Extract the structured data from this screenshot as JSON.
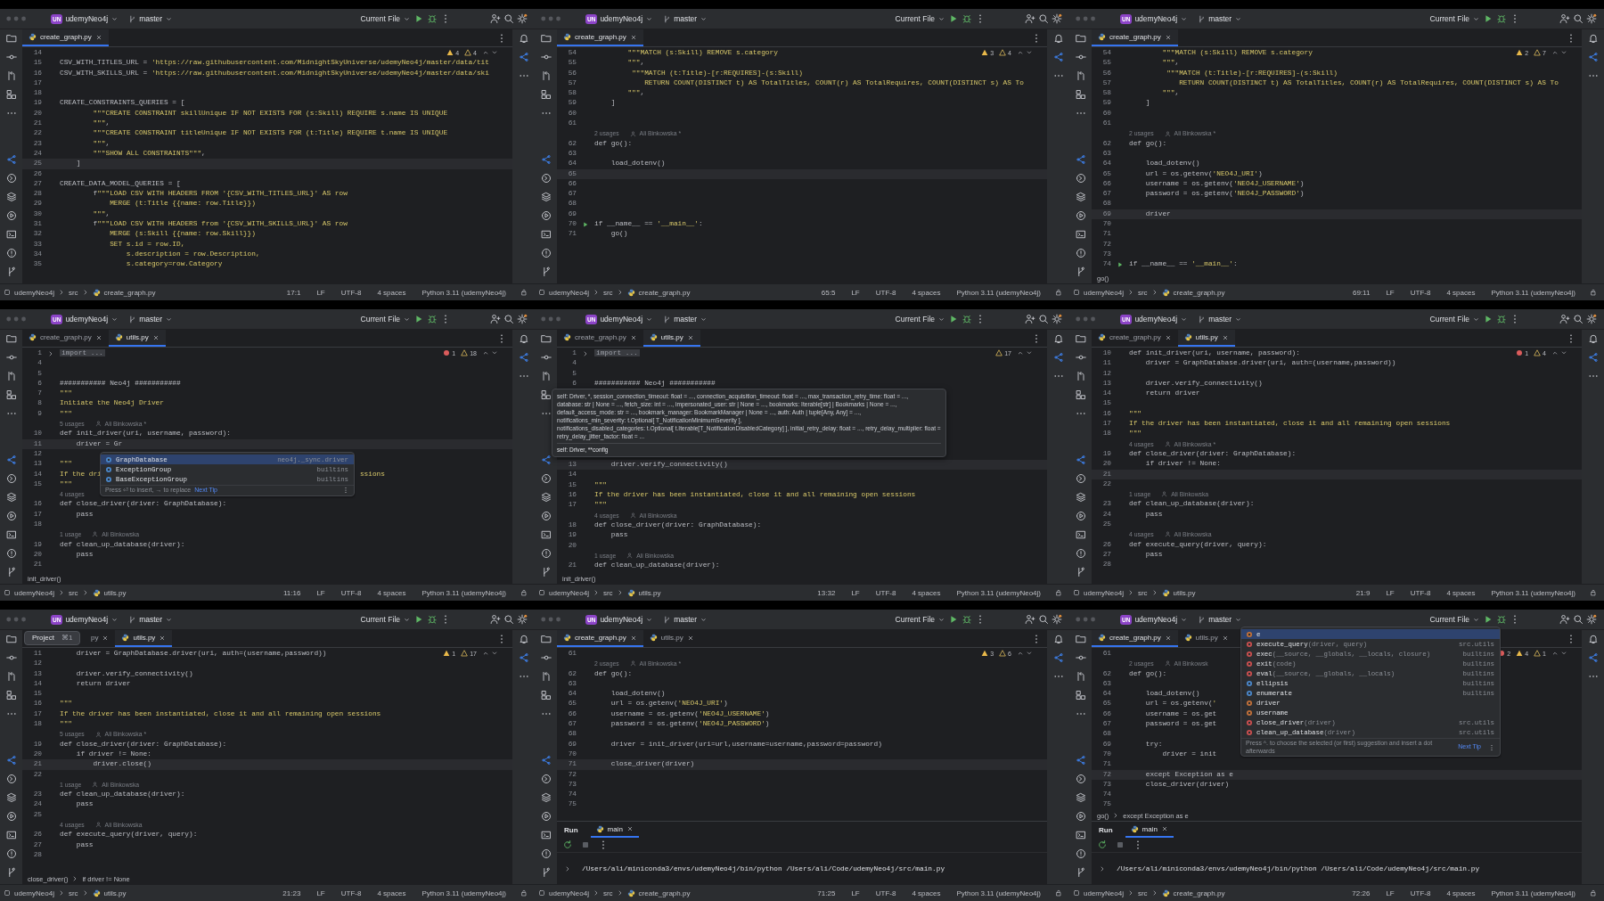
{
  "panels": [
    {
      "project_badge": "UN",
      "project": "udemyNeo4j",
      "branch": "master",
      "run_config": "Current File",
      "tabs": [
        {
          "label": "create_graph.py",
          "selected": true,
          "partial": false
        }
      ],
      "inspections": [
        {
          "kind": "warning",
          "count": "4"
        },
        {
          "kind": "weak",
          "count": "4"
        }
      ],
      "lines": [
        {
          "kind": "code",
          "n": "14"
        },
        {
          "kind": "code",
          "n": "15",
          "text": "CSV_WITH_TITLES_URL = 'https://raw.githubusercontent.com/MidnightSkyUniverse/udemyNeo4j/master/data/tit"
        },
        {
          "kind": "code",
          "n": "16",
          "text": "CSV_WITH_SKILLS_URL = 'https://raw.githubusercontent.com/MidnightSkyUniverse/udemyNeo4j/master/data/ski"
        },
        {
          "kind": "code",
          "n": "17"
        },
        {
          "kind": "code",
          "n": "18"
        },
        {
          "kind": "code",
          "n": "19",
          "text": "CREATE_CONSTRAINTS_QUERIES = ["
        },
        {
          "kind": "code",
          "n": "20",
          "text": "        \"\"\"CREATE CONSTRAINT skillUnique IF NOT EXISTS FOR (s:Skill) REQUIRE s.name IS UNIQUE"
        },
        {
          "kind": "code",
          "n": "21",
          "text": "        \"\"\","
        },
        {
          "kind": "code",
          "n": "22",
          "text": "        \"\"\"CREATE CONSTRAINT titleUnique IF NOT EXISTS FOR (t:Title) REQUIRE t.name IS UNIQUE"
        },
        {
          "kind": "code",
          "n": "23",
          "text": "        \"\"\","
        },
        {
          "kind": "code",
          "n": "24",
          "text": "        \"\"\"SHOW ALL CONSTRAINTS\"\"\","
        },
        {
          "kind": "current",
          "n": "25",
          "text": "    ]"
        },
        {
          "kind": "code",
          "n": "26"
        },
        {
          "kind": "code",
          "n": "27",
          "text": "CREATE_DATA_MODEL_QUERIES = ["
        },
        {
          "kind": "code",
          "n": "28",
          "text": "        f\"\"\"LOAD CSV WITH HEADERS FROM '{CSV_WITH_TITLES_URL}' AS row"
        },
        {
          "kind": "code",
          "n": "29",
          "text": "            MERGE (t:Title {{name: row.Title}})"
        },
        {
          "kind": "code",
          "n": "30",
          "text": "        \"\"\","
        },
        {
          "kind": "code",
          "n": "31",
          "text": "        f\"\"\"LOAD CSV WITH HEADERS from '{CSV_WITH_SKILLS_URL}' AS row"
        },
        {
          "kind": "code",
          "n": "32",
          "text": "            MERGE (s:Skill {{name: row.Skill}})"
        },
        {
          "kind": "code",
          "n": "33",
          "text": "            SET s.id = row.ID,"
        },
        {
          "kind": "code",
          "n": "34",
          "text": "                s.description = row.Description,"
        },
        {
          "kind": "code",
          "n": "35",
          "text": "                s.category=row.Category"
        }
      ],
      "status": {
        "path": [
          "udemyNeo4j",
          "src",
          "create_graph.py"
        ],
        "position": "17:1",
        "line_sep": "LF",
        "encoding": "UTF-8",
        "indent": "4 spaces",
        "interpreter": "Python 3.11 (udemyNeo4j)"
      }
    },
    {
      "project_badge": "UN",
      "project": "udemyNeo4j",
      "branch": "master",
      "run_config": "Current File",
      "tabs": [
        {
          "label": "create_graph.py",
          "selected": true,
          "partial": false
        }
      ],
      "inspections": [
        {
          "kind": "warning",
          "count": "3"
        },
        {
          "kind": "weak",
          "count": "4"
        }
      ],
      "lines": [
        {
          "kind": "code",
          "n": "54",
          "text": "        \"\"\"MATCH (s:Skill) REMOVE s.category"
        },
        {
          "kind": "code",
          "n": "55",
          "text": "        \"\"\","
        },
        {
          "kind": "code",
          "n": "56",
          "text": "         \"\"\"MATCH (t:Title)-[r:REQUIRES]-(s:Skill)"
        },
        {
          "kind": "code",
          "n": "57",
          "text": "            RETURN COUNT(DISTINCT t) AS TotalTitles, COUNT(r) AS TotalRequires, COUNT(DISTINCT s) AS To"
        },
        {
          "kind": "code",
          "n": "58",
          "text": "        \"\"\","
        },
        {
          "kind": "code",
          "n": "59",
          "text": "    ]"
        },
        {
          "kind": "code",
          "n": "60"
        },
        {
          "kind": "code",
          "n": "61"
        },
        {
          "kind": "hint",
          "usages": "2 usages",
          "author": "Ali Binkowska *"
        },
        {
          "kind": "code",
          "n": "62",
          "text": "def go():"
        },
        {
          "kind": "code",
          "n": "63"
        },
        {
          "kind": "code",
          "n": "64",
          "text": "    load_dotenv()"
        },
        {
          "kind": "current",
          "n": "65"
        },
        {
          "kind": "code",
          "n": "66"
        },
        {
          "kind": "code",
          "n": "67"
        },
        {
          "kind": "code",
          "n": "68"
        },
        {
          "kind": "code",
          "n": "69"
        },
        {
          "kind": "runnable",
          "n": "70",
          "text": "if __name__ == '__main__':"
        },
        {
          "kind": "code",
          "n": "71",
          "text": "    go()"
        }
      ],
      "status": {
        "path": [
          "udemyNeo4j",
          "src",
          "create_graph.py"
        ],
        "position": "65:5",
        "line_sep": "LF",
        "encoding": "UTF-8",
        "indent": "4 spaces",
        "interpreter": "Python 3.11 (udemyNeo4j)"
      }
    },
    {
      "project_badge": "UN",
      "project": "udemyNeo4j",
      "branch": "master",
      "run_config": "Current File",
      "tabs": [
        {
          "label": "create_graph.py",
          "selected": true,
          "partial": false
        }
      ],
      "inspections": [
        {
          "kind": "warning",
          "count": "2"
        },
        {
          "kind": "weak",
          "count": "7"
        }
      ],
      "lines": [
        {
          "kind": "code",
          "n": "54",
          "text": "        \"\"\"MATCH (s:Skill) REMOVE s.category"
        },
        {
          "kind": "code",
          "n": "55",
          "text": "        \"\"\","
        },
        {
          "kind": "code",
          "n": "56",
          "text": "         \"\"\"MATCH (t:Title)-[r:REQUIRES]-(s:Skill)"
        },
        {
          "kind": "code",
          "n": "57",
          "text": "            RETURN COUNT(DISTINCT t) AS TotalTitles, COUNT(r) AS TotalRequires, COUNT(DISTINCT s) AS To"
        },
        {
          "kind": "code",
          "n": "58",
          "text": "        \"\"\","
        },
        {
          "kind": "code",
          "n": "59",
          "text": "    ]"
        },
        {
          "kind": "code",
          "n": "60"
        },
        {
          "kind": "code",
          "n": "61"
        },
        {
          "kind": "hint",
          "usages": "2 usages",
          "author": "Ali Binkowska *"
        },
        {
          "kind": "code",
          "n": "62",
          "text": "def go():"
        },
        {
          "kind": "code",
          "n": "63"
        },
        {
          "kind": "code",
          "n": "64",
          "text": "    load_dotenv()"
        },
        {
          "kind": "code",
          "n": "65",
          "text": "    url = os.getenv('NEO4J_URI')"
        },
        {
          "kind": "code",
          "n": "66",
          "text": "    username = os.getenv('NEO4J_USERNAME')"
        },
        {
          "kind": "code",
          "n": "67",
          "text": "    password = os.getenv('NEO4J_PASSWORD')"
        },
        {
          "kind": "code",
          "n": "68"
        },
        {
          "kind": "current",
          "n": "69",
          "text": "    driver"
        },
        {
          "kind": "code",
          "n": "70"
        },
        {
          "kind": "code",
          "n": "71"
        },
        {
          "kind": "code",
          "n": "72"
        },
        {
          "kind": "code",
          "n": "73"
        },
        {
          "kind": "runnable",
          "n": "74",
          "text": "if __name__ == '__main__':"
        }
      ],
      "breadcrumb": [
        "go()"
      ],
      "status": {
        "path": [
          "udemyNeo4j",
          "src",
          "create_graph.py"
        ],
        "position": "69:11",
        "line_sep": "LF",
        "encoding": "UTF-8",
        "indent": "4 spaces",
        "interpreter": "Python 3.11 (udemyNeo4j)"
      }
    },
    {
      "project_badge": "UN",
      "project": "udemyNeo4j",
      "branch": "master",
      "run_config": "Current File",
      "tabs": [
        {
          "label": "create_graph.py",
          "selected": false,
          "partial": false
        },
        {
          "label": "utils.py",
          "selected": true,
          "partial": false
        }
      ],
      "inspections": [
        {
          "kind": "error",
          "count": "1"
        },
        {
          "kind": "weak",
          "count": "18"
        }
      ],
      "lines": [
        {
          "kind": "folded",
          "n": "1",
          "text": "import ..."
        },
        {
          "kind": "code",
          "n": "4"
        },
        {
          "kind": "code",
          "n": "5"
        },
        {
          "kind": "code",
          "n": "6",
          "text": "########### Neo4j ###########"
        },
        {
          "kind": "code",
          "n": "7",
          "text": "\"\"\""
        },
        {
          "kind": "code",
          "n": "8",
          "text": "Initiate the Neo4j Driver"
        },
        {
          "kind": "code",
          "n": "9",
          "text": "\"\"\""
        },
        {
          "kind": "hint",
          "usages": "5 usages",
          "author": "Ali Binkowska *"
        },
        {
          "kind": "code",
          "n": "10",
          "text": "def init_driver(uri, username, password):"
        },
        {
          "kind": "current",
          "n": "11",
          "text": "    driver = Gr"
        },
        {
          "kind": "code",
          "n": "12"
        },
        {
          "kind": "code",
          "n": "13",
          "text": "\"\"\""
        },
        {
          "kind": "code",
          "n": "14",
          "text": "If the dri",
          "tail": "ssions"
        },
        {
          "kind": "code",
          "n": "15",
          "text": "\"\"\""
        },
        {
          "kind": "hint",
          "usages": "4 usages"
        },
        {
          "kind": "code",
          "n": "16",
          "text": "def close_driver(driver: GraphDatabase):"
        },
        {
          "kind": "code",
          "n": "17",
          "text": "    pass"
        },
        {
          "kind": "code",
          "n": "18"
        },
        {
          "kind": "hint",
          "usages": "1 usage",
          "author": "Ali Binkowska"
        },
        {
          "kind": "code",
          "n": "19",
          "text": "def clean_up_database(driver):"
        },
        {
          "kind": "code",
          "n": "20",
          "text": "    pass"
        },
        {
          "kind": "code",
          "n": "21"
        }
      ],
      "breadcrumb": [
        "init_driver()"
      ],
      "completion": {
        "items": [
          {
            "kind": "class",
            "name": "GraphDatabase",
            "source": "neo4j._sync.driver",
            "selected": true
          },
          {
            "kind": "class",
            "name": "ExceptionGroup",
            "source": "builtins",
            "selected": false
          },
          {
            "kind": "class",
            "name": "BaseExceptionGroup",
            "source": "builtins",
            "selected": false
          }
        ],
        "footer": "Press ⏎ to insert, → to replace",
        "tip_link": "Next Tip"
      },
      "status": {
        "path": [
          "udemyNeo4j",
          "src",
          "utils.py"
        ],
        "position": "11:16",
        "line_sep": "LF",
        "encoding": "UTF-8",
        "indent": "4 spaces",
        "interpreter": "Python 3.11 (udemyNeo4j)"
      }
    },
    {
      "project_badge": "UN",
      "project": "udemyNeo4j",
      "branch": "master",
      "run_config": "Current File",
      "tabs": [
        {
          "label": "create_graph.py",
          "selected": false,
          "partial": false
        },
        {
          "label": "utils.py",
          "selected": true,
          "partial": false
        }
      ],
      "inspections": [
        {
          "kind": "weak",
          "count": "17"
        }
      ],
      "lines": [
        {
          "kind": "folded",
          "n": "1",
          "text": "import ..."
        },
        {
          "kind": "code",
          "n": "4"
        },
        {
          "kind": "code",
          "n": "5"
        },
        {
          "kind": "code",
          "n": "6",
          "text": "########### Neo4j ###########"
        },
        {
          "kind": "param_info",
          "lines": [
            "self: Driver, *, session_connection_timeout: float = ..., connection_acquisition_timeout: float = ..., max_transaction_retry_time: float = ...,",
            "database: str | None = ..., fetch_size: int = ..., impersonated_user: str | None = ..., bookmarks: Iterable[str] | Bookmarks | None = ...,",
            "default_access_mode: str = ..., bookmark_manager: BookmarkManager | None = ..., auth: Auth | tuple[Any, Any] = ...,",
            "notifications_min_severity: t.Optional[ T_NotificationMinimumSeverity ],",
            "notifications_disabled_categories: t.Optional[ t.Iterable[T_NotificationDisabledCategory] ], initial_retry_delay: float = ..., retry_delay_multiplier: float =",
            "retry_delay_jitter_factor: float = ..."
          ],
          "footer": "self: Driver, **config"
        },
        {
          "kind": "current",
          "n": "13",
          "text": "    driver.verify_connectivity()"
        },
        {
          "kind": "code",
          "n": "14"
        },
        {
          "kind": "code",
          "n": "15",
          "text": "\"\"\""
        },
        {
          "kind": "code",
          "n": "16",
          "text": "If the driver has been instantiated, close it and all remaining open sessions"
        },
        {
          "kind": "code",
          "n": "17",
          "text": "\"\"\""
        },
        {
          "kind": "hint",
          "usages": "4 usages",
          "author": "Ali Binkowska"
        },
        {
          "kind": "code",
          "n": "18",
          "text": "def close_driver(driver: GraphDatabase):"
        },
        {
          "kind": "code",
          "n": "19",
          "text": "    pass"
        },
        {
          "kind": "code",
          "n": "20"
        },
        {
          "kind": "hint",
          "usages": "1 usage",
          "author": "Ali Binkowska"
        },
        {
          "kind": "code",
          "n": "21",
          "text": "def clean_up_database(driver):"
        }
      ],
      "breadcrumb": [
        "init_driver()"
      ],
      "status": {
        "path": [
          "udemyNeo4j",
          "src",
          "utils.py"
        ],
        "position": "13:32",
        "line_sep": "LF",
        "encoding": "UTF-8",
        "indent": "4 spaces",
        "interpreter": "Python 3.11 (udemyNeo4j)"
      }
    },
    {
      "project_badge": "UN",
      "project": "udemyNeo4j",
      "branch": "master",
      "run_config": "Current File",
      "tabs": [
        {
          "label": "create_graph.py",
          "selected": false,
          "partial": false
        },
        {
          "label": "utils.py",
          "selected": true,
          "partial": false
        }
      ],
      "inspections": [
        {
          "kind": "error",
          "count": "1"
        },
        {
          "kind": "weak",
          "count": "4"
        }
      ],
      "lines": [
        {
          "kind": "code",
          "n": "10",
          "text": "def init_driver(uri, username, password):"
        },
        {
          "kind": "code",
          "n": "11",
          "text": "    driver = GraphDatabase.driver(uri, auth=(username,password))"
        },
        {
          "kind": "code",
          "n": "12"
        },
        {
          "kind": "code",
          "n": "13",
          "text": "    driver.verify_connectivity()"
        },
        {
          "kind": "code",
          "n": "14",
          "text": "    return driver"
        },
        {
          "kind": "code",
          "n": "15"
        },
        {
          "kind": "code",
          "n": "16",
          "text": "\"\"\""
        },
        {
          "kind": "code",
          "n": "17",
          "text": "If the driver has been instantiated, close it and all remaining open sessions"
        },
        {
          "kind": "code",
          "n": "18",
          "text": "\"\"\""
        },
        {
          "kind": "hint",
          "usages": "4 usages",
          "author": "Ali Binkowska *"
        },
        {
          "kind": "code",
          "n": "19",
          "text": "def close_driver(driver: GraphDatabase):"
        },
        {
          "kind": "code",
          "n": "20",
          "text": "    if driver != None:"
        },
        {
          "kind": "current",
          "n": "21"
        },
        {
          "kind": "code",
          "n": "22"
        },
        {
          "kind": "hint",
          "usages": "1 usage",
          "author": "Ali Binkowska"
        },
        {
          "kind": "code",
          "n": "23",
          "text": "def clean_up_database(driver):"
        },
        {
          "kind": "code",
          "n": "24",
          "text": "    pass"
        },
        {
          "kind": "code",
          "n": "25"
        },
        {
          "kind": "hint",
          "usages": "4 usages",
          "author": "Ali Binkowska"
        },
        {
          "kind": "code",
          "n": "26",
          "text": "def execute_query(driver, query):"
        },
        {
          "kind": "code",
          "n": "27",
          "text": "    pass"
        },
        {
          "kind": "code",
          "n": "28"
        }
      ],
      "status": {
        "path": [
          "udemyNeo4j",
          "src",
          "utils.py"
        ],
        "position": "21:9",
        "line_sep": "LF",
        "encoding": "UTF-8",
        "indent": "4 spaces",
        "interpreter": "Python 3.11 (udemyNeo4j)"
      }
    },
    {
      "project_badge": "UN",
      "project": "udemyNeo4j",
      "branch": "master",
      "run_config": "Current File",
      "tooltip": {
        "label": "Project",
        "shortcut": "⌘1"
      },
      "tabs": [
        {
          "label": "py",
          "selected": false,
          "partial": true
        },
        {
          "label": "utils.py",
          "selected": true,
          "partial": false
        }
      ],
      "inspections": [
        {
          "kind": "warning",
          "count": "1"
        },
        {
          "kind": "weak",
          "count": "17"
        }
      ],
      "lines": [
        {
          "kind": "code",
          "n": "11",
          "text": "    driver = GraphDatabase.driver(uri, auth=(username,password))"
        },
        {
          "kind": "code",
          "n": "12"
        },
        {
          "kind": "code",
          "n": "13",
          "text": "    driver.verify_connectivity()"
        },
        {
          "kind": "code",
          "n": "14",
          "text": "    return driver"
        },
        {
          "kind": "code",
          "n": "15"
        },
        {
          "kind": "code",
          "n": "16",
          "text": "\"\"\""
        },
        {
          "kind": "code",
          "n": "17",
          "text": "If the driver has been instantiated, close it and all remaining open sessions"
        },
        {
          "kind": "code",
          "n": "18",
          "text": "\"\"\""
        },
        {
          "kind": "hint",
          "usages": "5 usages",
          "author": "Ali Binkowska *"
        },
        {
          "kind": "code",
          "n": "19",
          "text": "def close_driver(driver: GraphDatabase):"
        },
        {
          "kind": "code",
          "n": "20",
          "text": "    if driver != None:"
        },
        {
          "kind": "current",
          "n": "21",
          "text": "        driver.close()"
        },
        {
          "kind": "code",
          "n": "22"
        },
        {
          "kind": "hint",
          "usages": "1 usage",
          "author": "Ali Binkowska"
        },
        {
          "kind": "code",
          "n": "23",
          "text": "def clean_up_database(driver):"
        },
        {
          "kind": "code",
          "n": "24",
          "text": "    pass"
        },
        {
          "kind": "code",
          "n": "25"
        },
        {
          "kind": "hint",
          "usages": "4 usages",
          "author": "Ali Binkowska"
        },
        {
          "kind": "code",
          "n": "26",
          "text": "def execute_query(driver, query):"
        },
        {
          "kind": "code",
          "n": "27",
          "text": "    pass"
        },
        {
          "kind": "code",
          "n": "28"
        }
      ],
      "breadcrumb": [
        "close_driver()",
        "if driver != None"
      ],
      "status": {
        "path": [
          "udemyNeo4j",
          "src",
          "utils.py"
        ],
        "position": "21:23",
        "line_sep": "LF",
        "encoding": "UTF-8",
        "indent": "4 spaces",
        "interpreter": "Python 3.11 (udemyNeo4j)"
      }
    },
    {
      "project_badge": "UN",
      "project": "udemyNeo4j",
      "branch": "master",
      "run_config": "Current File",
      "tabs": [
        {
          "label": "create_graph.py",
          "selected": true,
          "partial": false
        },
        {
          "label": "utils.py",
          "selected": false,
          "partial": false
        }
      ],
      "inspections": [
        {
          "kind": "warning",
          "count": "3"
        },
        {
          "kind": "weak",
          "count": "6"
        }
      ],
      "lines": [
        {
          "kind": "code",
          "n": "61"
        },
        {
          "kind": "hint",
          "usages": "2 usages",
          "author": "Ali Binkowska *"
        },
        {
          "kind": "code",
          "n": "62",
          "text": "def go():"
        },
        {
          "kind": "code",
          "n": "63"
        },
        {
          "kind": "code",
          "n": "64",
          "text": "    load_dotenv()"
        },
        {
          "kind": "code",
          "n": "65",
          "text": "    url = os.getenv('NEO4J_URI')"
        },
        {
          "kind": "code",
          "n": "66",
          "text": "    username = os.getenv('NEO4J_USERNAME')"
        },
        {
          "kind": "code",
          "n": "67",
          "text": "    password = os.getenv('NEO4J_PASSWORD')"
        },
        {
          "kind": "code",
          "n": "68"
        },
        {
          "kind": "code",
          "n": "69",
          "text": "    driver = init_driver(uri=url,username=username,password=password)"
        },
        {
          "kind": "code",
          "n": "70"
        },
        {
          "kind": "current",
          "n": "71",
          "text": "    close_driver(driver)"
        },
        {
          "kind": "code",
          "n": "72"
        },
        {
          "kind": "code",
          "n": "73"
        },
        {
          "kind": "code",
          "n": "74"
        },
        {
          "kind": "code",
          "n": "75"
        }
      ],
      "run_panel": {
        "title": "Run",
        "tabs": [
          {
            "label": "main",
            "selected": true
          }
        ],
        "output": "/Users/ali/miniconda3/envs/udemyNeo4j/bin/python /Users/ali/Code/udemyNeo4j/src/main.py"
      },
      "status": {
        "path": [
          "udemyNeo4j",
          "src",
          "create_graph.py"
        ],
        "position": "71:25",
        "line_sep": "LF",
        "encoding": "UTF-8",
        "indent": "4 spaces",
        "interpreter": "Python 3.11 (udemyNeo4j)"
      }
    },
    {
      "project_badge": "UN",
      "project": "udemyNeo4j",
      "branch": "master",
      "run_config": "Current File",
      "tabs": [
        {
          "label": "create_graph.py",
          "selected": true,
          "partial": false
        },
        {
          "label": "utils.py",
          "selected": false,
          "partial": false
        }
      ],
      "inspections": [
        {
          "kind": "error",
          "count": "2"
        },
        {
          "kind": "warning",
          "count": "4"
        },
        {
          "kind": "weak",
          "count": "1"
        }
      ],
      "lines": [
        {
          "kind": "code",
          "n": "61"
        },
        {
          "kind": "hint",
          "usages": "2 usages",
          "author": "Ali Binkowsk"
        },
        {
          "kind": "code",
          "n": "62",
          "text": "def go():"
        },
        {
          "kind": "code",
          "n": "63"
        },
        {
          "kind": "code",
          "n": "64",
          "text": "    load_dotenv()"
        },
        {
          "kind": "code",
          "n": "65",
          "text": "    url = os.getenv('"
        },
        {
          "kind": "code",
          "n": "66",
          "text": "    username = os.get"
        },
        {
          "kind": "code",
          "n": "67",
          "text": "    password = os.get"
        },
        {
          "kind": "code",
          "n": "68"
        },
        {
          "kind": "code",
          "n": "69",
          "text": "    try:"
        },
        {
          "kind": "code",
          "n": "70",
          "text": "        driver = init"
        },
        {
          "kind": "code",
          "n": "71"
        },
        {
          "kind": "current",
          "n": "72",
          "text": "    except Exception as e"
        },
        {
          "kind": "code",
          "n": "73",
          "text": "    close_driver(driver)"
        },
        {
          "kind": "code",
          "n": "74"
        },
        {
          "kind": "code",
          "n": "75"
        }
      ],
      "breadcrumb": [
        "go()",
        "except Exception as e"
      ],
      "completion": {
        "items": [
          {
            "kind": "variable",
            "name": "e",
            "selected": true
          },
          {
            "kind": "function",
            "name": "execute_query",
            "params": "(driver, query)",
            "source": "src.utils",
            "selected": false
          },
          {
            "kind": "function",
            "name": "exec",
            "params": "(__source, __globals, __locals, closure)",
            "source": "builtins",
            "selected": false
          },
          {
            "kind": "function",
            "name": "exit",
            "params": "(code)",
            "source": "builtins",
            "selected": false
          },
          {
            "kind": "function",
            "name": "eval",
            "params": "(__source, __globals, __locals)",
            "source": "builtins",
            "selected": false
          },
          {
            "kind": "class",
            "name": "ellipsis",
            "source": "builtins",
            "selected": false
          },
          {
            "kind": "class",
            "name": "enumerate",
            "source": "builtins",
            "selected": false
          },
          {
            "kind": "variable",
            "name": "driver",
            "selected": false
          },
          {
            "kind": "variable",
            "name": "username",
            "selected": false
          },
          {
            "kind": "function",
            "name": "close_driver",
            "params": "(driver)",
            "source": "src.utils",
            "selected": false
          },
          {
            "kind": "function",
            "name": "clean_up_database",
            "params": "(driver)",
            "source": "src.utils",
            "selected": false
          }
        ],
        "footer": "Press ^. to choose the selected (or first) suggestion and insert a dot afterwards",
        "tip_link": "Next Tip"
      },
      "run_panel": {
        "title": "Run",
        "tabs": [
          {
            "label": "main",
            "selected": true
          }
        ],
        "output": "/Users/ali/miniconda3/envs/udemyNeo4j/bin/python /Users/ali/Code/udemyNeo4j/src/main.py"
      },
      "status": {
        "path": [
          "udemyNeo4j",
          "src",
          "create_graph.py"
        ],
        "position": "72:26",
        "line_sep": "LF",
        "encoding": "UTF-8",
        "indent": "4 spaces",
        "interpreter": "Python 3.11 (udemyNeo4j)"
      }
    }
  ]
}
